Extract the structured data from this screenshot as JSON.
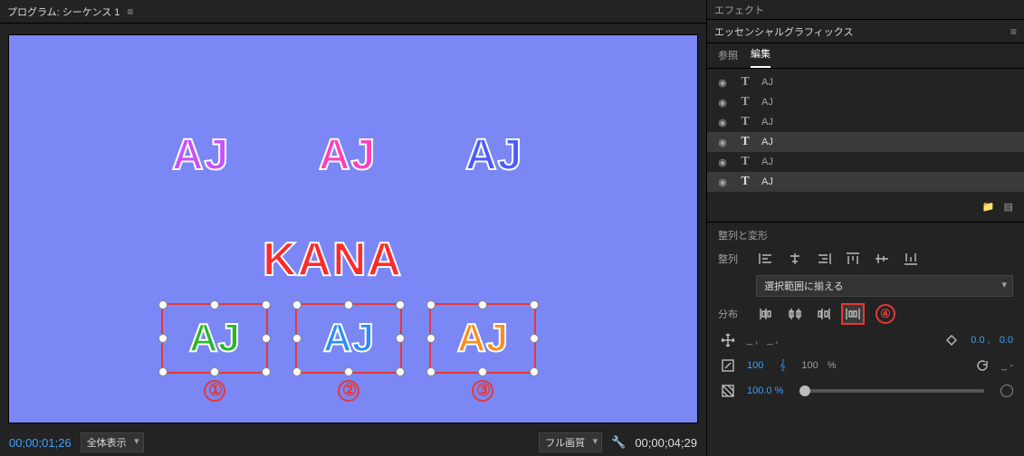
{
  "program": {
    "title": "プログラム: シーケンス 1",
    "timecode_in": "00;00;01;26",
    "timecode_out": "00;00;04;29",
    "fit_dropdown": "全体表示",
    "quality_dropdown": "フル画質",
    "canvas": {
      "top_texts": [
        "AJ",
        "AJ",
        "AJ"
      ],
      "middle_text": "KANA",
      "selected_texts": [
        "AJ",
        "AJ",
        "AJ"
      ],
      "marks": [
        "①",
        "②",
        "③"
      ]
    }
  },
  "effects_panel": {
    "title": "エフェクト"
  },
  "eg": {
    "title": "エッセンシャルグラフィックス",
    "tabs": {
      "browse": "参照",
      "edit": "編集"
    },
    "layers": [
      {
        "label": "AJ",
        "selected": false
      },
      {
        "label": "AJ",
        "selected": false
      },
      {
        "label": "AJ",
        "selected": false
      },
      {
        "label": "AJ",
        "selected": true
      },
      {
        "label": "AJ",
        "selected": false
      },
      {
        "label": "AJ",
        "selected": true
      }
    ],
    "section": "整列と変形",
    "align_label": "整列",
    "align_to": "選択範囲に揃える",
    "distribute_label": "分布",
    "annotation4": "④",
    "transform": {
      "pos_x": "_ ,",
      "pos_y": "_ ,",
      "anchor_x": "0.0 ,",
      "anchor_y": "0.0",
      "scale": "100",
      "link": "100",
      "pct": "%",
      "rotation": "_ -",
      "opacity": "100.0 %"
    }
  }
}
